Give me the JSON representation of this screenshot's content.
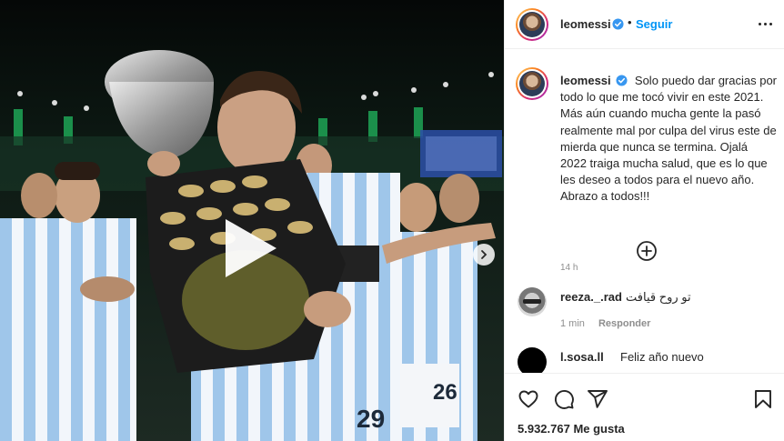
{
  "header": {
    "username": "leomessi",
    "separator": "•",
    "follow_label": "Seguir"
  },
  "caption": {
    "username": "leomessi",
    "text": "Solo puedo dar gracias por todo lo que me tocó vivir en este 2021. Más aún cuando mucha gente la pasó realmente mal por culpa del virus este de mierda que nunca se termina. Ojalá 2022 traiga mucha salud, que es lo que les deseo a todos para el nuevo año. Abrazo a todos!!!",
    "time": "14 h"
  },
  "comments": [
    {
      "username": "reeza._.rad",
      "text": "تو روح قیافت",
      "time": "1 min",
      "reply_label": "Responder"
    },
    {
      "username": "l.sosa.ll",
      "text": "Feliz año nuevo"
    }
  ],
  "actions": {
    "likes": "5.932.767 Me gusta"
  },
  "media": {
    "jersey_numbers": [
      "29",
      "26"
    ]
  },
  "colors": {
    "accent": "#0095f6",
    "verified": "#3897f0",
    "text": "#262626",
    "muted": "#8e8e8e"
  },
  "icons": [
    "play-icon",
    "chevron-right-icon",
    "verified-icon",
    "more-icon",
    "plus-circle-icon",
    "heart-icon",
    "comment-icon",
    "share-icon",
    "bookmark-icon"
  ]
}
